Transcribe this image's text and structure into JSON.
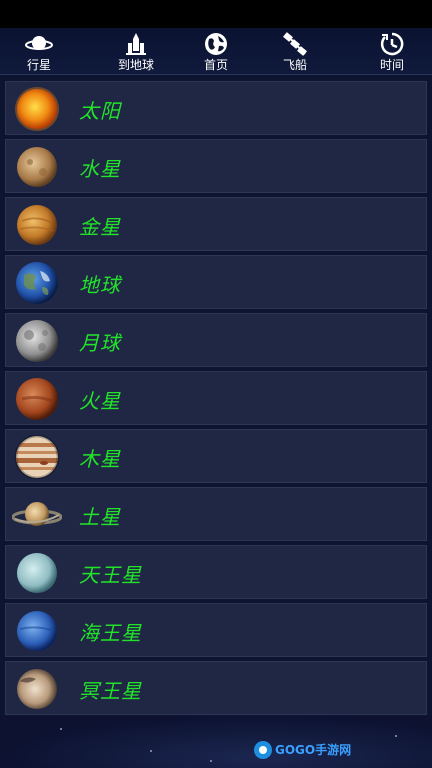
{
  "tabs": [
    {
      "label": "行星",
      "icon": "saturn-icon"
    },
    {
      "label": "到地球",
      "icon": "rocket-icon"
    },
    {
      "label": "首页",
      "icon": "globe-icon"
    },
    {
      "label": "飞船",
      "icon": "satellite-icon"
    },
    {
      "label": "时间",
      "icon": "clock-icon"
    }
  ],
  "planets": [
    {
      "name": "太阳",
      "icon": "sun-icon"
    },
    {
      "name": "水星",
      "icon": "mercury-icon"
    },
    {
      "name": "金星",
      "icon": "venus-icon"
    },
    {
      "name": "地球",
      "icon": "earth-icon"
    },
    {
      "name": "月球",
      "icon": "moon-icon"
    },
    {
      "name": "火星",
      "icon": "mars-icon"
    },
    {
      "name": "木星",
      "icon": "jupiter-icon"
    },
    {
      "name": "土星",
      "icon": "saturn-planet-icon"
    },
    {
      "name": "天王星",
      "icon": "uranus-icon"
    },
    {
      "name": "海王星",
      "icon": "neptune-icon"
    },
    {
      "name": "冥王星",
      "icon": "pluto-icon"
    }
  ],
  "watermark": {
    "brand": "GOGO手游网"
  },
  "colors": {
    "name_text": "#22e32a",
    "row_bg": "#202744",
    "page_bg": "#0d1430"
  }
}
